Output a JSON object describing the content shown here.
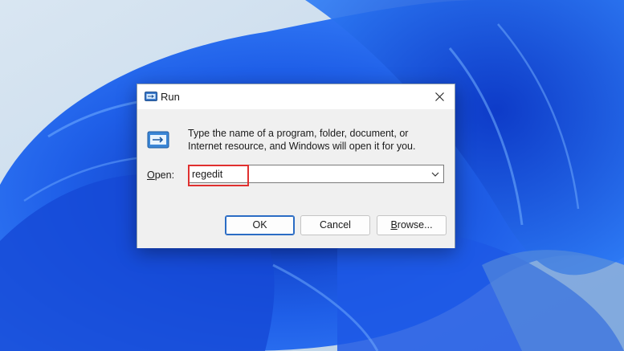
{
  "dialog": {
    "title": "Run",
    "description": "Type the name of a program, folder, document, or Internet resource, and Windows will open it for you.",
    "open_label_first": "O",
    "open_label_rest": "pen:",
    "input_value": "regedit",
    "ok_label": "OK",
    "cancel_label": "Cancel",
    "browse_label_first": "B",
    "browse_label_rest": "rowse...",
    "icons": [
      "run-icon",
      "close-icon",
      "run-program-icon",
      "chevron-down-icon"
    ]
  },
  "colors": {
    "accent": "#2b6cc4",
    "highlight": "#e0302f",
    "dialog_bg": "#f0f0f0"
  }
}
